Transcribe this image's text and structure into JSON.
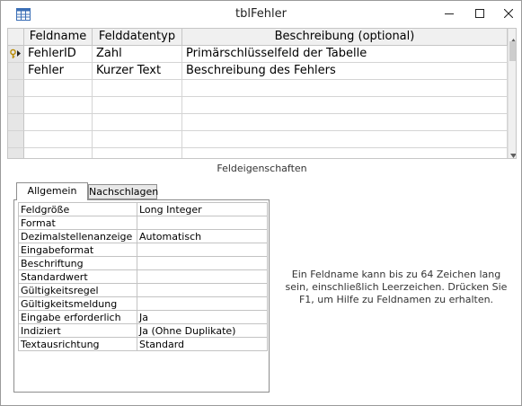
{
  "window": {
    "title": "tblFehler",
    "icons": [
      "table-icon",
      "minimize-icon",
      "maximize-icon",
      "close-icon"
    ]
  },
  "grid": {
    "columns": [
      "Feldname",
      "Felddatentyp",
      "Beschreibung (optional)"
    ],
    "rows": [
      {
        "name": "FehlerID",
        "type": "Zahl",
        "desc": "Primärschlüsselfeld der Tabelle",
        "primary_key": true
      },
      {
        "name": "Fehler",
        "type": "Kurzer Text",
        "desc": "Beschreibung des Fehlers",
        "primary_key": false
      }
    ]
  },
  "properties": {
    "section_label": "Feldeigenschaften",
    "tabs": [
      "Allgemein",
      "Nachschlagen"
    ],
    "active_tab": "Allgemein",
    "items": [
      {
        "name": "Feldgröße",
        "value": "Long Integer"
      },
      {
        "name": "Format",
        "value": ""
      },
      {
        "name": "Dezimalstellenanzeige",
        "value": "Automatisch"
      },
      {
        "name": "Eingabeformat",
        "value": ""
      },
      {
        "name": "Beschriftung",
        "value": ""
      },
      {
        "name": "Standardwert",
        "value": ""
      },
      {
        "name": "Gültigkeitsregel",
        "value": ""
      },
      {
        "name": "Gültigkeitsmeldung",
        "value": ""
      },
      {
        "name": "Eingabe erforderlich",
        "value": "Ja"
      },
      {
        "name": "Indiziert",
        "value": "Ja (Ohne Duplikate)"
      },
      {
        "name": "Textausrichtung",
        "value": "Standard"
      }
    ],
    "help": "Ein Feldname kann bis zu 64 Zeichen lang sein, einschließlich Leerzeichen. Drücken Sie F1, um Hilfe zu Feldnamen zu erhalten."
  },
  "colors": {
    "selector_gray": "#e6e6e6",
    "header_gray": "#f0f0f0",
    "grid_line": "#d4d4d4",
    "key_icon": "#d4a017"
  }
}
